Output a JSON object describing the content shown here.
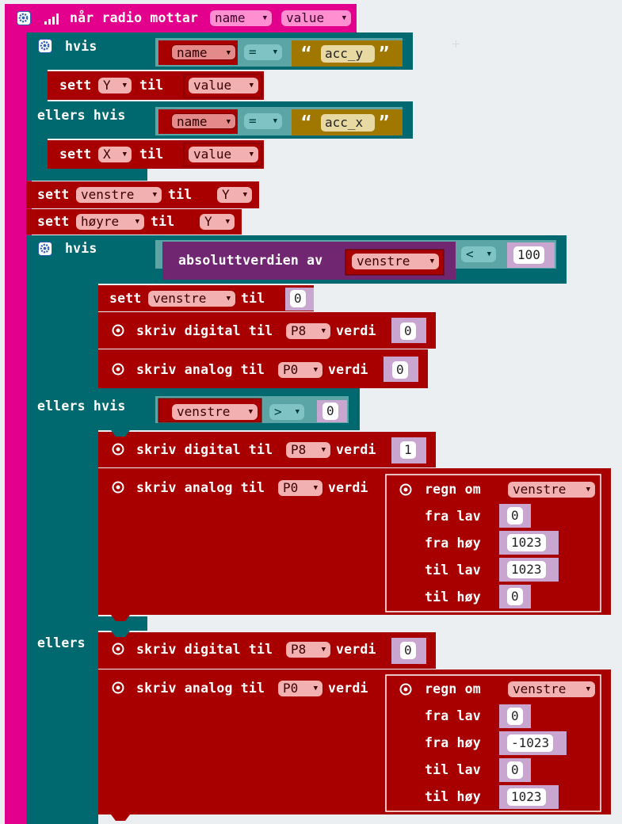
{
  "event": {
    "label": "når radio mottar",
    "param1": "name",
    "param2": "value"
  },
  "if1": {
    "if_label": "hvis",
    "cond1": {
      "var": "name",
      "op": "=",
      "str": "acc_y"
    },
    "set1": {
      "sett": "sett",
      "var": "Y",
      "til": "til",
      "value": "value"
    },
    "elseif_label": "ellers hvis",
    "cond2": {
      "var": "name",
      "op": "=",
      "str": "acc_x"
    },
    "set2": {
      "sett": "sett",
      "var": "X",
      "til": "til",
      "value": "value"
    }
  },
  "set_venstre": {
    "sett": "sett",
    "var": "venstre",
    "til": "til",
    "value": "Y"
  },
  "set_hoyre": {
    "sett": "sett",
    "var": "høyre",
    "til": "til",
    "value": "Y"
  },
  "if2": {
    "if_label": "hvis",
    "abs_label": "absoluttverdien av",
    "abs_var": "venstre",
    "op": "<",
    "num": "100",
    "b1": {
      "sett": "sett",
      "var": "venstre",
      "til": "til",
      "value": "0"
    },
    "b2": {
      "label": "skriv digital til",
      "pin": "P8",
      "verdi": "verdi",
      "value": "0"
    },
    "b3": {
      "label": "skriv analog til",
      "pin": "P0",
      "verdi": "verdi",
      "value": "0"
    },
    "elseif_label": "ellers hvis",
    "cond2": {
      "var": "venstre",
      "op": ">",
      "num": "0"
    },
    "b4": {
      "label": "skriv digital til",
      "pin": "P8",
      "verdi": "verdi",
      "value": "1"
    },
    "b5": {
      "label": "skriv analog til",
      "pin": "P0",
      "verdi": "verdi",
      "map": {
        "label": "regn om",
        "var": "venstre",
        "rows": [
          {
            "label": "fra lav",
            "value": "0"
          },
          {
            "label": "fra høy",
            "value": "1023"
          },
          {
            "label": "til lav",
            "value": "1023"
          },
          {
            "label": "til høy",
            "value": "0"
          }
        ]
      }
    },
    "else_label": "ellers",
    "b6": {
      "label": "skriv digital til",
      "pin": "P8",
      "verdi": "verdi",
      "value": "0"
    },
    "b7": {
      "label": "skriv analog til",
      "pin": "P0",
      "verdi": "verdi",
      "map": {
        "label": "regn om",
        "var": "venstre",
        "rows": [
          {
            "label": "fra lav",
            "value": "0"
          },
          {
            "label": "fra høy",
            "value": "-1023"
          },
          {
            "label": "til lav",
            "value": "0"
          },
          {
            "label": "til høy",
            "value": "1023"
          }
        ]
      }
    }
  },
  "colors": {
    "event": "#e3008c",
    "logic": "#006970",
    "vars": "#a80000",
    "text": "#a07800",
    "math": "#712672",
    "pins": "#a80000"
  }
}
